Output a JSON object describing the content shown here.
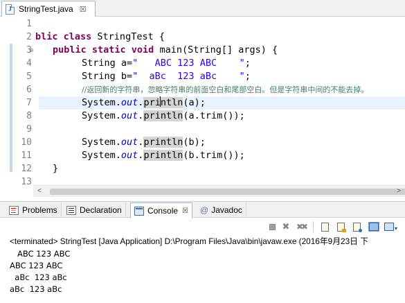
{
  "editor_tab": {
    "icon": "java-file-icon",
    "icon_glyph": "J",
    "label": "StringTest.java",
    "close_glyph": "☒"
  },
  "gutter": {
    "line_numbers": [
      "1",
      "2",
      "3",
      "4",
      "5",
      "6",
      "7",
      "8",
      "9",
      "10",
      "11",
      "12",
      "13"
    ],
    "fold_marker_line": "3",
    "fold_glyph": "⊖"
  },
  "code": {
    "line2_kw1": "blic",
    "line2_kw2": "class",
    "line2_rest": " StringTest {",
    "line3_kw": "public static void",
    "line3_rest": " main(String[] args) {",
    "line4_pre": "String a=",
    "line4_str": "\"   ABC 123 ABC    \"",
    "line4_end": ";",
    "line5_pre": "String b=",
    "line5_str": "\"  aBc  123 aBc    \"",
    "line5_end": ";",
    "line6_comment": "//返回新的字符串，忽略字符串的前面空白和尾部空白。但是字符串中间的不能去掉。",
    "line7_a": "System.",
    "line7_out": "out",
    "line7_b": ".",
    "line7_m1": "pri",
    "line7_m2": "ntln",
    "line7_c": "(a);",
    "line8_a": "System.",
    "line8_out": "out",
    "line8_b": ".",
    "line8_m": "println",
    "line8_c": "(a.trim());",
    "line10_a": "System.",
    "line10_out": "out",
    "line10_b": ".",
    "line10_m": "println",
    "line10_c": "(b);",
    "line11_a": "System.",
    "line11_out": "out",
    "line11_b": ".",
    "line11_m": "println",
    "line11_c": "(b.trim());",
    "line12": "}"
  },
  "scrollbar": {
    "left_arrow": "<",
    "right_arrow": ">"
  },
  "views": {
    "problems": "Problems",
    "declaration": "Declaration",
    "console": "Console",
    "console_close": "☒",
    "javadoc_icon": "@",
    "javadoc": "Javadoc"
  },
  "console_toolbar": {
    "terminate_icon": "stop-icon",
    "remove_launch_glyph": "✖",
    "remove_all_glyph": "✖✖",
    "dropdown_glyph": "▾"
  },
  "console": {
    "status": "<terminated> StringTest [Java Application] D:\\Program Files\\Java\\bin\\javaw.exe (2016年9月23日 下",
    "output": [
      "   ABC 123 ABC    ",
      "ABC 123 ABC",
      "  aBc  123 aBc    ",
      "aBc  123 aBc"
    ]
  },
  "colors": {
    "keyword": "#7f0055",
    "string": "#2a00ff",
    "comment": "#3f7f5f",
    "static_field": "#0000c0",
    "current_line": "#e8f2fe",
    "occurrence": "#d4d4d4"
  }
}
